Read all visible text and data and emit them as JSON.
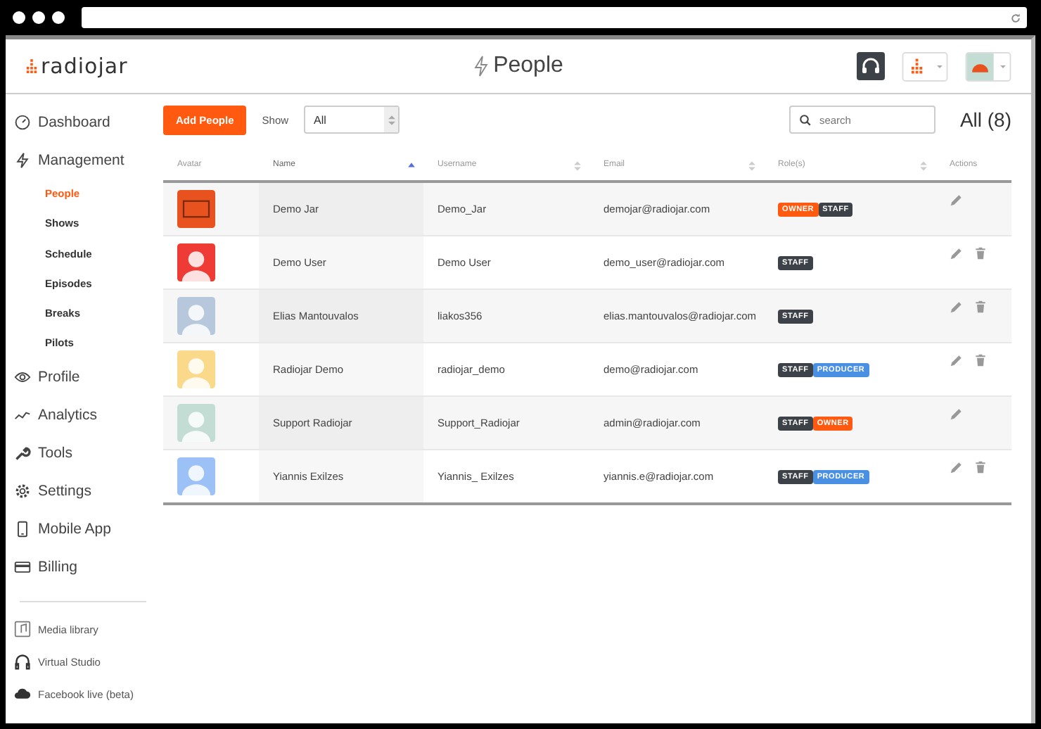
{
  "app": {
    "logo": "radiojar",
    "title": "People"
  },
  "sidebar": {
    "items": [
      {
        "label": "Dashboard",
        "selected": false
      },
      {
        "label": "Management",
        "selected": false,
        "children": [
          {
            "label": "People",
            "selected": true
          },
          {
            "label": "Shows",
            "selected": false
          },
          {
            "label": "Schedule",
            "selected": false
          },
          {
            "label": "Episodes",
            "selected": false
          },
          {
            "label": "Breaks",
            "selected": false
          },
          {
            "label": "Pilots",
            "selected": false
          }
        ]
      },
      {
        "label": "Profile",
        "selected": false
      },
      {
        "label": "Analytics",
        "selected": false
      },
      {
        "label": "Tools",
        "selected": false
      },
      {
        "label": "Settings",
        "selected": false
      },
      {
        "label": "Mobile App",
        "selected": false
      },
      {
        "label": "Billing",
        "selected": false
      }
    ],
    "extras": [
      "Media library",
      "Virtual Studio",
      "Facebook live (beta)"
    ]
  },
  "toolbar": {
    "add_button": "Add People",
    "show_label": "Show",
    "show_value": "All",
    "search": {
      "placeholder": "search"
    },
    "count": "All (8)"
  },
  "table": {
    "columns": [
      {
        "label": "Avatar",
        "sortable": false,
        "sorted": false
      },
      {
        "label": "Name",
        "sortable": true,
        "sorted": true
      },
      {
        "label": "Username",
        "sortable": true,
        "sorted": false
      },
      {
        "label": "Email",
        "sortable": true,
        "sorted": false
      },
      {
        "label": "Role(s)",
        "sortable": true,
        "sorted": false
      },
      {
        "label": "Actions",
        "sortable": false,
        "sorted": false
      }
    ],
    "rows": [
      {
        "kind": "photo",
        "color": "#e8521f",
        "name": "Demo Jar",
        "username": "Demo_Jar",
        "email": "demojar@radiojar.com",
        "roles": [
          {
            "label": "OWNER",
            "kind": "owner"
          },
          {
            "label": "STAFF",
            "kind": "staff"
          }
        ],
        "deletable": false
      },
      {
        "kind": "person",
        "color": "#ee3b35",
        "name": "Demo User",
        "username": "Demo User",
        "email": "demo_user@radiojar.com",
        "roles": [
          {
            "label": "STAFF",
            "kind": "staff"
          }
        ],
        "deletable": true
      },
      {
        "kind": "person",
        "color": "#b7c8dc",
        "name": "Elias Mantouvalos",
        "username": "liakos356",
        "email": "elias.mantouvalos@radiojar.com",
        "roles": [
          {
            "label": "STAFF",
            "kind": "staff"
          }
        ],
        "deletable": true
      },
      {
        "kind": "person",
        "color": "#fbd98a",
        "name": "Radiojar Demo",
        "username": "radiojar_demo",
        "email": "demo@radiojar.com",
        "roles": [
          {
            "label": "STAFF",
            "kind": "staff"
          },
          {
            "label": "PRODUCER",
            "kind": "producer"
          }
        ],
        "deletable": true
      },
      {
        "kind": "person",
        "color": "#c3ddd5",
        "name": "Support Radiojar",
        "username": "Support_Radiojar",
        "email": "admin@radiojar.com",
        "roles": [
          {
            "label": "STAFF",
            "kind": "staff"
          },
          {
            "label": "OWNER",
            "kind": "owner"
          }
        ],
        "deletable": false
      },
      {
        "kind": "person",
        "color": "#9cc1f7",
        "name": "Yiannis Exilzes",
        "username": "Yiannis_ Exilzes",
        "email": "yiannis.e@radiojar.com",
        "roles": [
          {
            "label": "STAFF",
            "kind": "staff"
          },
          {
            "label": "PRODUCER",
            "kind": "producer"
          }
        ],
        "deletable": true
      }
    ]
  }
}
